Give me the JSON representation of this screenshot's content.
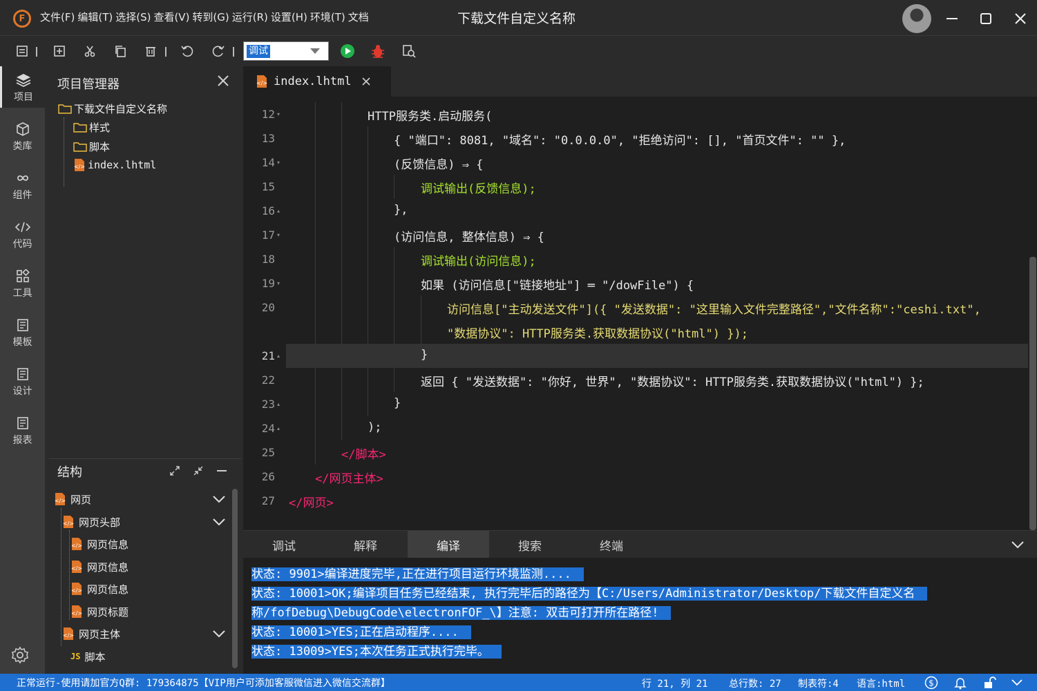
{
  "titlebar": {
    "logo": "F",
    "menu": [
      "文件(F)",
      "编辑(T)",
      "选择(S)",
      "查看(V)",
      "转到(G)",
      "运行(R)",
      "设置(H)",
      "环境(T)",
      "文档"
    ],
    "title": "下载文件自定义名称"
  },
  "toolbar": {
    "run_mode": "调试"
  },
  "activity": [
    {
      "label": "项目",
      "icon": "layers-icon"
    },
    {
      "label": "类库",
      "icon": "cube-icon"
    },
    {
      "label": "组件",
      "icon": "infinity-icon"
    },
    {
      "label": "代码",
      "icon": "code-icon"
    },
    {
      "label": "工具",
      "icon": "grid-icon"
    },
    {
      "label": "模板",
      "icon": "template-icon"
    },
    {
      "label": "设计",
      "icon": "design-icon"
    },
    {
      "label": "报表",
      "icon": "report-icon"
    }
  ],
  "explorer": {
    "title": "项目管理器",
    "tree": [
      "下载文件自定义名称",
      "样式",
      "脚本",
      "index.lhtml"
    ]
  },
  "structure": {
    "title": "结构",
    "items": [
      "网页",
      "网页头部",
      "网页信息",
      "网页信息",
      "网页信息",
      "网页标题",
      "网页主体",
      "脚本"
    ]
  },
  "editor": {
    "tab": "index.lhtml",
    "line_numbers": [
      "12",
      "13",
      "14",
      "15",
      "16",
      "17",
      "18",
      "19",
      "20",
      "",
      "21",
      "22",
      "23",
      "24",
      "25",
      "26",
      "27"
    ],
    "lines": [
      "HTTP服务类.启动服务(",
      "{ \"端口\": 8081, \"域名\": \"0.0.0.0\", \"拒绝访问\": [], \"首页文件\": \"\" },",
      "(反馈信息) ⇒ {",
      "调试输出(反馈信息);",
      "},",
      "(访问信息, 整体信息) ⇒ {",
      "调试输出(访问信息);",
      "如果 (访问信息[\"链接地址\"] ═ \"/dowFile\") {",
      "访问信息[\"主动发送文件\"]({ \"发送数据\": \"这里输入文件完整路径\",\"文件名称\":\"ceshi.txt\",",
      "\"数据协议\": HTTP服务类.获取数据协议(\"html\") });",
      "}",
      "返回 { \"发送数据\": \"你好, 世界\", \"数据协议\": HTTP服务类.获取数据协议(\"html\") };",
      "}",
      ");",
      "</脚本>",
      "</网页主体>",
      "</网页>"
    ]
  },
  "output": {
    "tabs": [
      "调试",
      "解释",
      "编译",
      "搜索",
      "终端"
    ],
    "active_tab": "编译",
    "lines": [
      "状态: 9901>编译进度完毕,正在进行项目运行环境监测....",
      "状态: 10001>OK;编译项目任务已经结束, 执行完毕后的路径为【C:/Users/Administrator/Desktop/下载文件自定义名",
      "称/fofDebug\\DebugCode\\electronFOF_\\】注意: 双击可打开所在路径!",
      "状态: 10001>YES;正在启动程序....",
      "状态: 13009>YES;本次任务正式执行完毕。"
    ]
  },
  "statusbar": {
    "left": "正常运行-使用请加官方Q群: 179364875【VIP用户可添加客服微信进入微信交流群】",
    "position": "行 21, 列 21",
    "total_lines": "总行数: 27",
    "tab_size": "制表符:4",
    "language": "语言:html"
  },
  "colors": {
    "accent": "#1f6fd1",
    "editor_bg": "#1f1f1f",
    "panel_bg": "#2b2b2b",
    "activity_bg": "#3c3c3c",
    "logo": "#e0772a"
  }
}
